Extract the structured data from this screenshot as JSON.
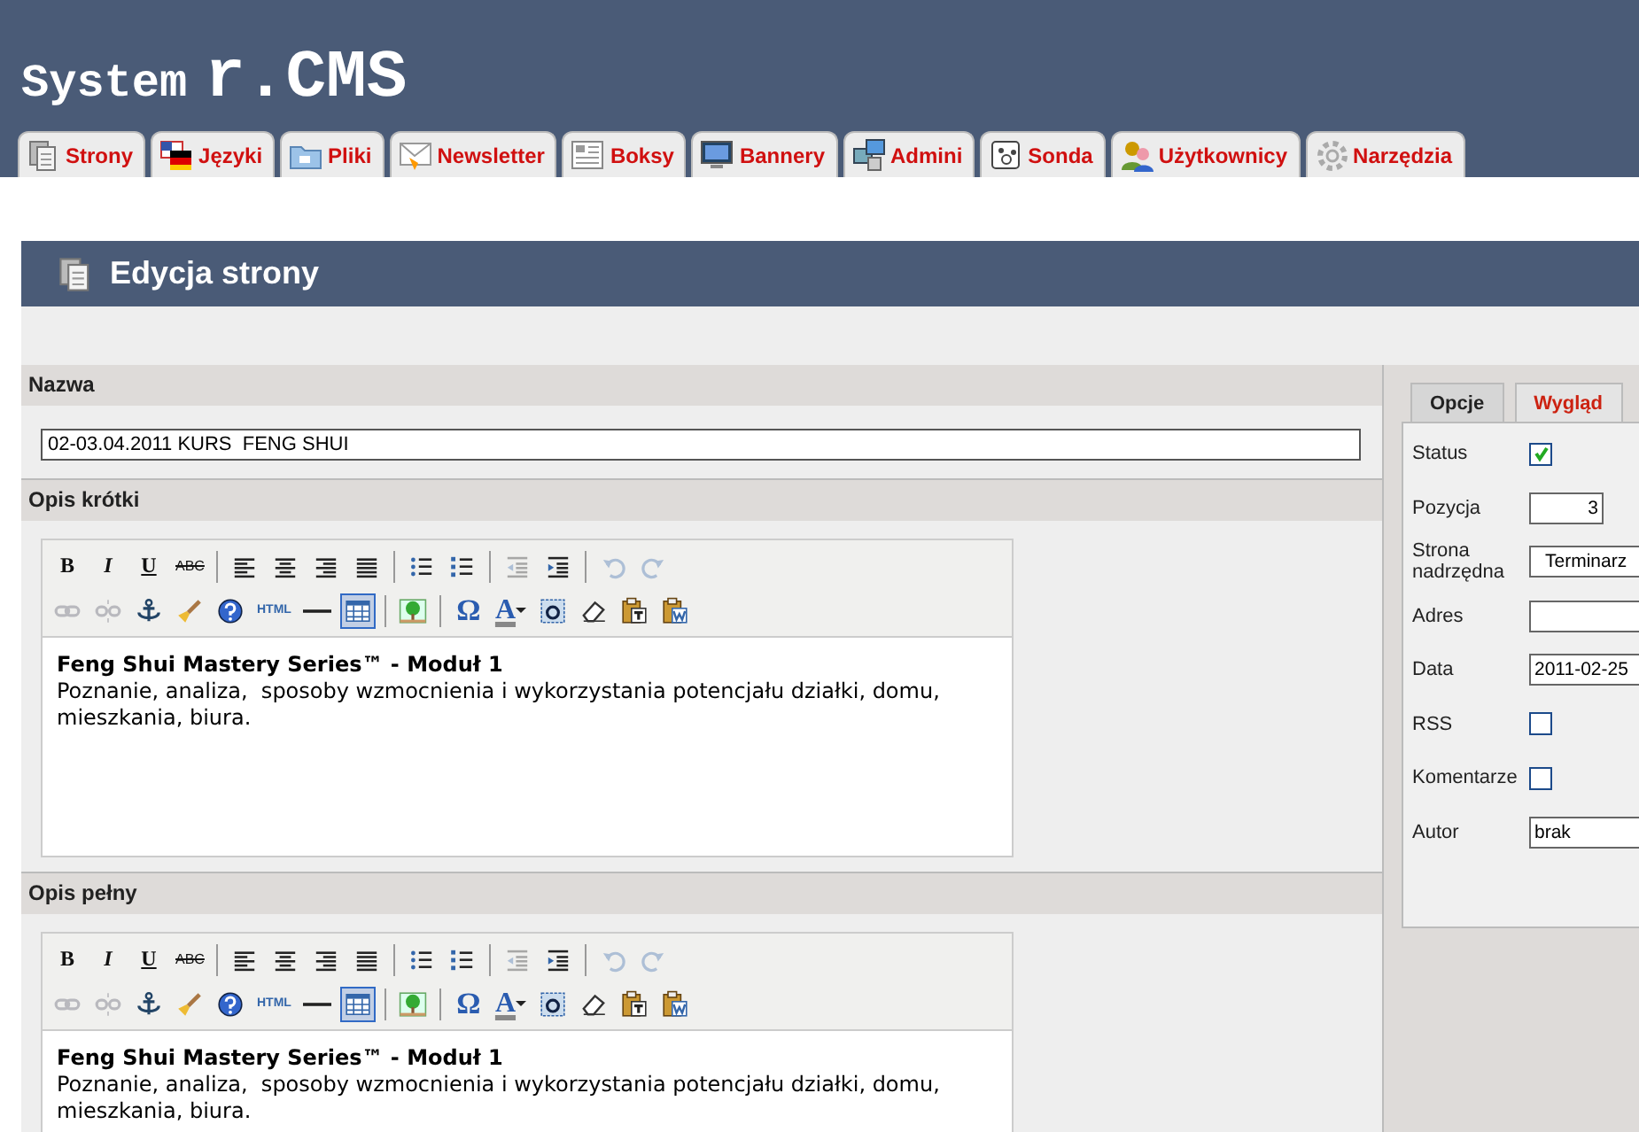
{
  "header": {
    "title_prefix": "System",
    "title_brand": "r.CMS"
  },
  "tabs": [
    {
      "label": "Strony"
    },
    {
      "label": "Języki"
    },
    {
      "label": "Pliki"
    },
    {
      "label": "Newsletter"
    },
    {
      "label": "Boksy"
    },
    {
      "label": "Bannery"
    },
    {
      "label": "Admini"
    },
    {
      "label": "Sonda"
    },
    {
      "label": "Użytkownicy"
    },
    {
      "label": "Narzędzia"
    }
  ],
  "page_header": {
    "title": "Edycja strony"
  },
  "form": {
    "name_label": "Nazwa",
    "name_value": "02-03.04.2011 KURS  FENG SHUI",
    "editors": [
      {
        "label": "Opis krótki",
        "heading": "Feng Shui Mastery Series™ - Moduł 1",
        "body": "Poznanie, analiza,  sposoby wzmocnienia i wykorzystania potencjału działki, domu, mieszkania, biura.",
        "toolbar": [
          [
            {
              "kind": "bold",
              "glyph": "B",
              "disabled": false,
              "active": false
            },
            {
              "kind": "italic",
              "glyph": "I",
              "disabled": false,
              "active": false
            },
            {
              "kind": "underline",
              "glyph": "U",
              "disabled": false,
              "active": false
            },
            {
              "kind": "strike",
              "glyph": "ABC",
              "disabled": false,
              "active": false
            },
            {
              "kind": "sep"
            },
            {
              "kind": "align-left",
              "disabled": false,
              "active": false
            },
            {
              "kind": "align-center",
              "disabled": false,
              "active": false
            },
            {
              "kind": "align-right",
              "disabled": false,
              "active": false
            },
            {
              "kind": "justify",
              "disabled": false,
              "active": false
            },
            {
              "kind": "sep"
            },
            {
              "kind": "bullet-list",
              "disabled": false,
              "active": false
            },
            {
              "kind": "numbered-list",
              "disabled": false,
              "active": false
            },
            {
              "kind": "sep"
            },
            {
              "kind": "outdent",
              "disabled": true,
              "active": false
            },
            {
              "kind": "indent",
              "disabled": false,
              "active": false
            },
            {
              "kind": "sep"
            },
            {
              "kind": "undo",
              "disabled": true,
              "active": false
            },
            {
              "kind": "redo",
              "disabled": true,
              "active": false
            }
          ],
          [
            {
              "kind": "link",
              "disabled": true,
              "active": false
            },
            {
              "kind": "unlink",
              "disabled": true,
              "active": false
            },
            {
              "kind": "anchor",
              "disabled": false,
              "active": false
            },
            {
              "kind": "brush",
              "disabled": false,
              "active": false
            },
            {
              "kind": "help",
              "disabled": false,
              "active": false
            },
            {
              "kind": "html",
              "glyph": "HTML",
              "disabled": false,
              "active": false
            },
            {
              "kind": "rule",
              "disabled": false,
              "active": false
            },
            {
              "kind": "table",
              "disabled": false,
              "active": true
            },
            {
              "kind": "sep"
            },
            {
              "kind": "image",
              "disabled": false,
              "active": false
            },
            {
              "kind": "sep"
            },
            {
              "kind": "charmap",
              "glyph": "Ω",
              "disabled": false,
              "active": false
            },
            {
              "kind": "text-color",
              "glyph": "A",
              "disabled": false,
              "active": false
            },
            {
              "kind": "highlight",
              "disabled": false,
              "active": false
            },
            {
              "kind": "eraser",
              "disabled": false,
              "active": false
            },
            {
              "kind": "paste-text",
              "disabled": false,
              "active": false
            },
            {
              "kind": "paste-word",
              "disabled": false,
              "active": false
            }
          ]
        ]
      },
      {
        "label": "Opis pełny",
        "heading": "Feng Shui Mastery Series™ - Moduł 1",
        "body": "Poznanie, analiza,  sposoby wzmocnienia i wykorzystania potencjału działki, domu, mieszkania, biura.",
        "toolbar": [
          [
            {
              "kind": "bold",
              "glyph": "B",
              "disabled": false,
              "active": false
            },
            {
              "kind": "italic",
              "glyph": "I",
              "disabled": false,
              "active": false
            },
            {
              "kind": "underline",
              "glyph": "U",
              "disabled": false,
              "active": false
            },
            {
              "kind": "strike",
              "glyph": "ABC",
              "disabled": false,
              "active": false
            },
            {
              "kind": "sep"
            },
            {
              "kind": "align-left",
              "disabled": false,
              "active": false
            },
            {
              "kind": "align-center",
              "disabled": false,
              "active": false
            },
            {
              "kind": "align-right",
              "disabled": false,
              "active": false
            },
            {
              "kind": "justify",
              "disabled": false,
              "active": false
            },
            {
              "kind": "sep"
            },
            {
              "kind": "bullet-list",
              "disabled": false,
              "active": false
            },
            {
              "kind": "numbered-list",
              "disabled": false,
              "active": false
            },
            {
              "kind": "sep"
            },
            {
              "kind": "outdent",
              "disabled": true,
              "active": false
            },
            {
              "kind": "indent",
              "disabled": false,
              "active": false
            },
            {
              "kind": "sep"
            },
            {
              "kind": "undo",
              "disabled": true,
              "active": false
            },
            {
              "kind": "redo",
              "disabled": true,
              "active": false
            }
          ],
          [
            {
              "kind": "link",
              "disabled": true,
              "active": false
            },
            {
              "kind": "unlink",
              "disabled": true,
              "active": false
            },
            {
              "kind": "anchor",
              "disabled": false,
              "active": false
            },
            {
              "kind": "brush",
              "disabled": false,
              "active": false
            },
            {
              "kind": "help",
              "disabled": false,
              "active": false
            },
            {
              "kind": "html",
              "glyph": "HTML",
              "disabled": false,
              "active": false
            },
            {
              "kind": "rule",
              "disabled": false,
              "active": false
            },
            {
              "kind": "table",
              "disabled": false,
              "active": true
            },
            {
              "kind": "sep"
            },
            {
              "kind": "image",
              "disabled": false,
              "active": false
            },
            {
              "kind": "sep"
            },
            {
              "kind": "charmap",
              "glyph": "Ω",
              "disabled": false,
              "active": false
            },
            {
              "kind": "text-color",
              "glyph": "A",
              "disabled": false,
              "active": false
            },
            {
              "kind": "highlight",
              "disabled": false,
              "active": false
            },
            {
              "kind": "eraser",
              "disabled": false,
              "active": false
            },
            {
              "kind": "paste-text",
              "disabled": false,
              "active": false
            },
            {
              "kind": "paste-word",
              "disabled": false,
              "active": false
            }
          ]
        ]
      }
    ]
  },
  "side_panel": {
    "tabs": [
      {
        "label": "Opcje",
        "selected": true
      },
      {
        "label": "Wygląd",
        "selected": false
      }
    ],
    "fields": [
      {
        "label": "Status",
        "kind": "checkbox",
        "checked": true
      },
      {
        "label": "Pozycja",
        "kind": "number",
        "value": "3"
      },
      {
        "label": "Strona nadrzędna",
        "kind": "select",
        "value": "Terminarz"
      },
      {
        "label": "Adres",
        "kind": "text"
      },
      {
        "label": "Data",
        "kind": "text",
        "value": "2011-02-25"
      },
      {
        "label": "RSS",
        "kind": "checkbox",
        "checked": false
      },
      {
        "label": "Komentarze",
        "kind": "checkbox",
        "checked": false
      },
      {
        "label": "Autor",
        "kind": "text",
        "value": "brak"
      }
    ]
  }
}
